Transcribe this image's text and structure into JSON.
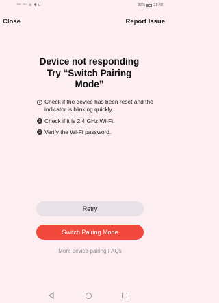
{
  "status_bar": {
    "signal": "ᴴᴵıl ᴴᴵıl",
    "icons_left": "≈ ✱ U",
    "battery": "32%",
    "time": "21:48"
  },
  "header": {
    "close_label": "Close",
    "report_label": "Report Issue"
  },
  "title": {
    "line1": "Device not responding",
    "line2": "Try “Switch Pairing",
    "line3": "Mode”"
  },
  "checklist": [
    {
      "num": "1",
      "text": "Check if the device has been reset and the indicator is blinking quickly."
    },
    {
      "num": "2",
      "text": "Check if it is 2.4 GHz Wi-Fi."
    },
    {
      "num": "3",
      "text": "Verify the Wi-Fi password."
    }
  ],
  "actions": {
    "retry_label": "Retry",
    "switch_label": "Switch Pairing Mode",
    "faq_label": "More device-pairing FAQs"
  },
  "colors": {
    "background": "#fceef1",
    "primary": "#f1483c",
    "secondary_button": "#e8e1e6"
  },
  "icons": {
    "nav_back": "back-triangle-icon",
    "nav_home": "home-circle-icon",
    "nav_recent": "recent-square-icon"
  }
}
